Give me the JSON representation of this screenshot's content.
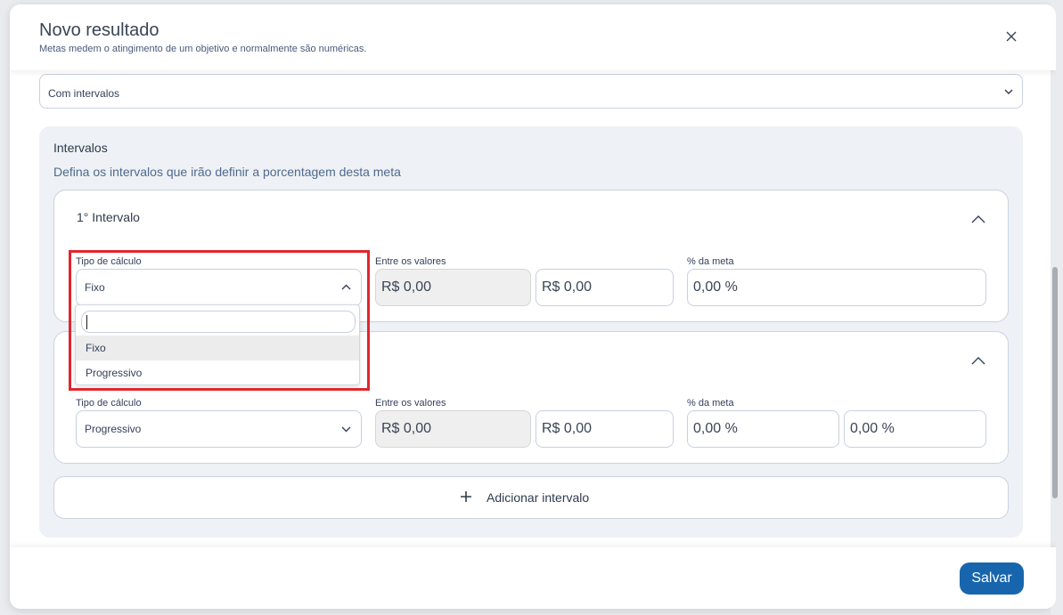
{
  "modal": {
    "title": "Novo resultado",
    "subtitle": "Metas medem o atingimento de um objetivo e normalmente são numéricas.",
    "close_icon": "close-icon"
  },
  "mode_select": {
    "value": "Com intervalos"
  },
  "intervals": {
    "title": "Intervalos",
    "description": "Defina os intervalos que irão definir a porcentagem desta meta",
    "cards": [
      {
        "title": "1° Intervalo",
        "calc_label": "Tipo de cálculo",
        "calc_value": "Fixo",
        "range_label": "Entre os valores",
        "range_from": "R$ 0,00",
        "range_to": "R$ 0,00",
        "goal_label": "% da meta",
        "goal_value": "0,00 %"
      },
      {
        "title": "",
        "calc_label": "Tipo de cálculo",
        "calc_value": "Progressivo",
        "range_label": "Entre os valores",
        "range_from": "R$ 0,00",
        "range_to": "R$ 0,00",
        "goal_label": "% da meta",
        "goal_from": "0,00 %",
        "goal_to": "0,00 %"
      }
    ],
    "add_label": "Adicionar intervalo"
  },
  "dropdown": {
    "search_value": "",
    "options": [
      "Fixo",
      "Progressivo"
    ],
    "selected": "Fixo"
  },
  "footer": {
    "save_label": "Salvar"
  },
  "colors": {
    "primary": "#1766ad",
    "highlight": "#e0262d",
    "panel": "#eef1f5"
  }
}
